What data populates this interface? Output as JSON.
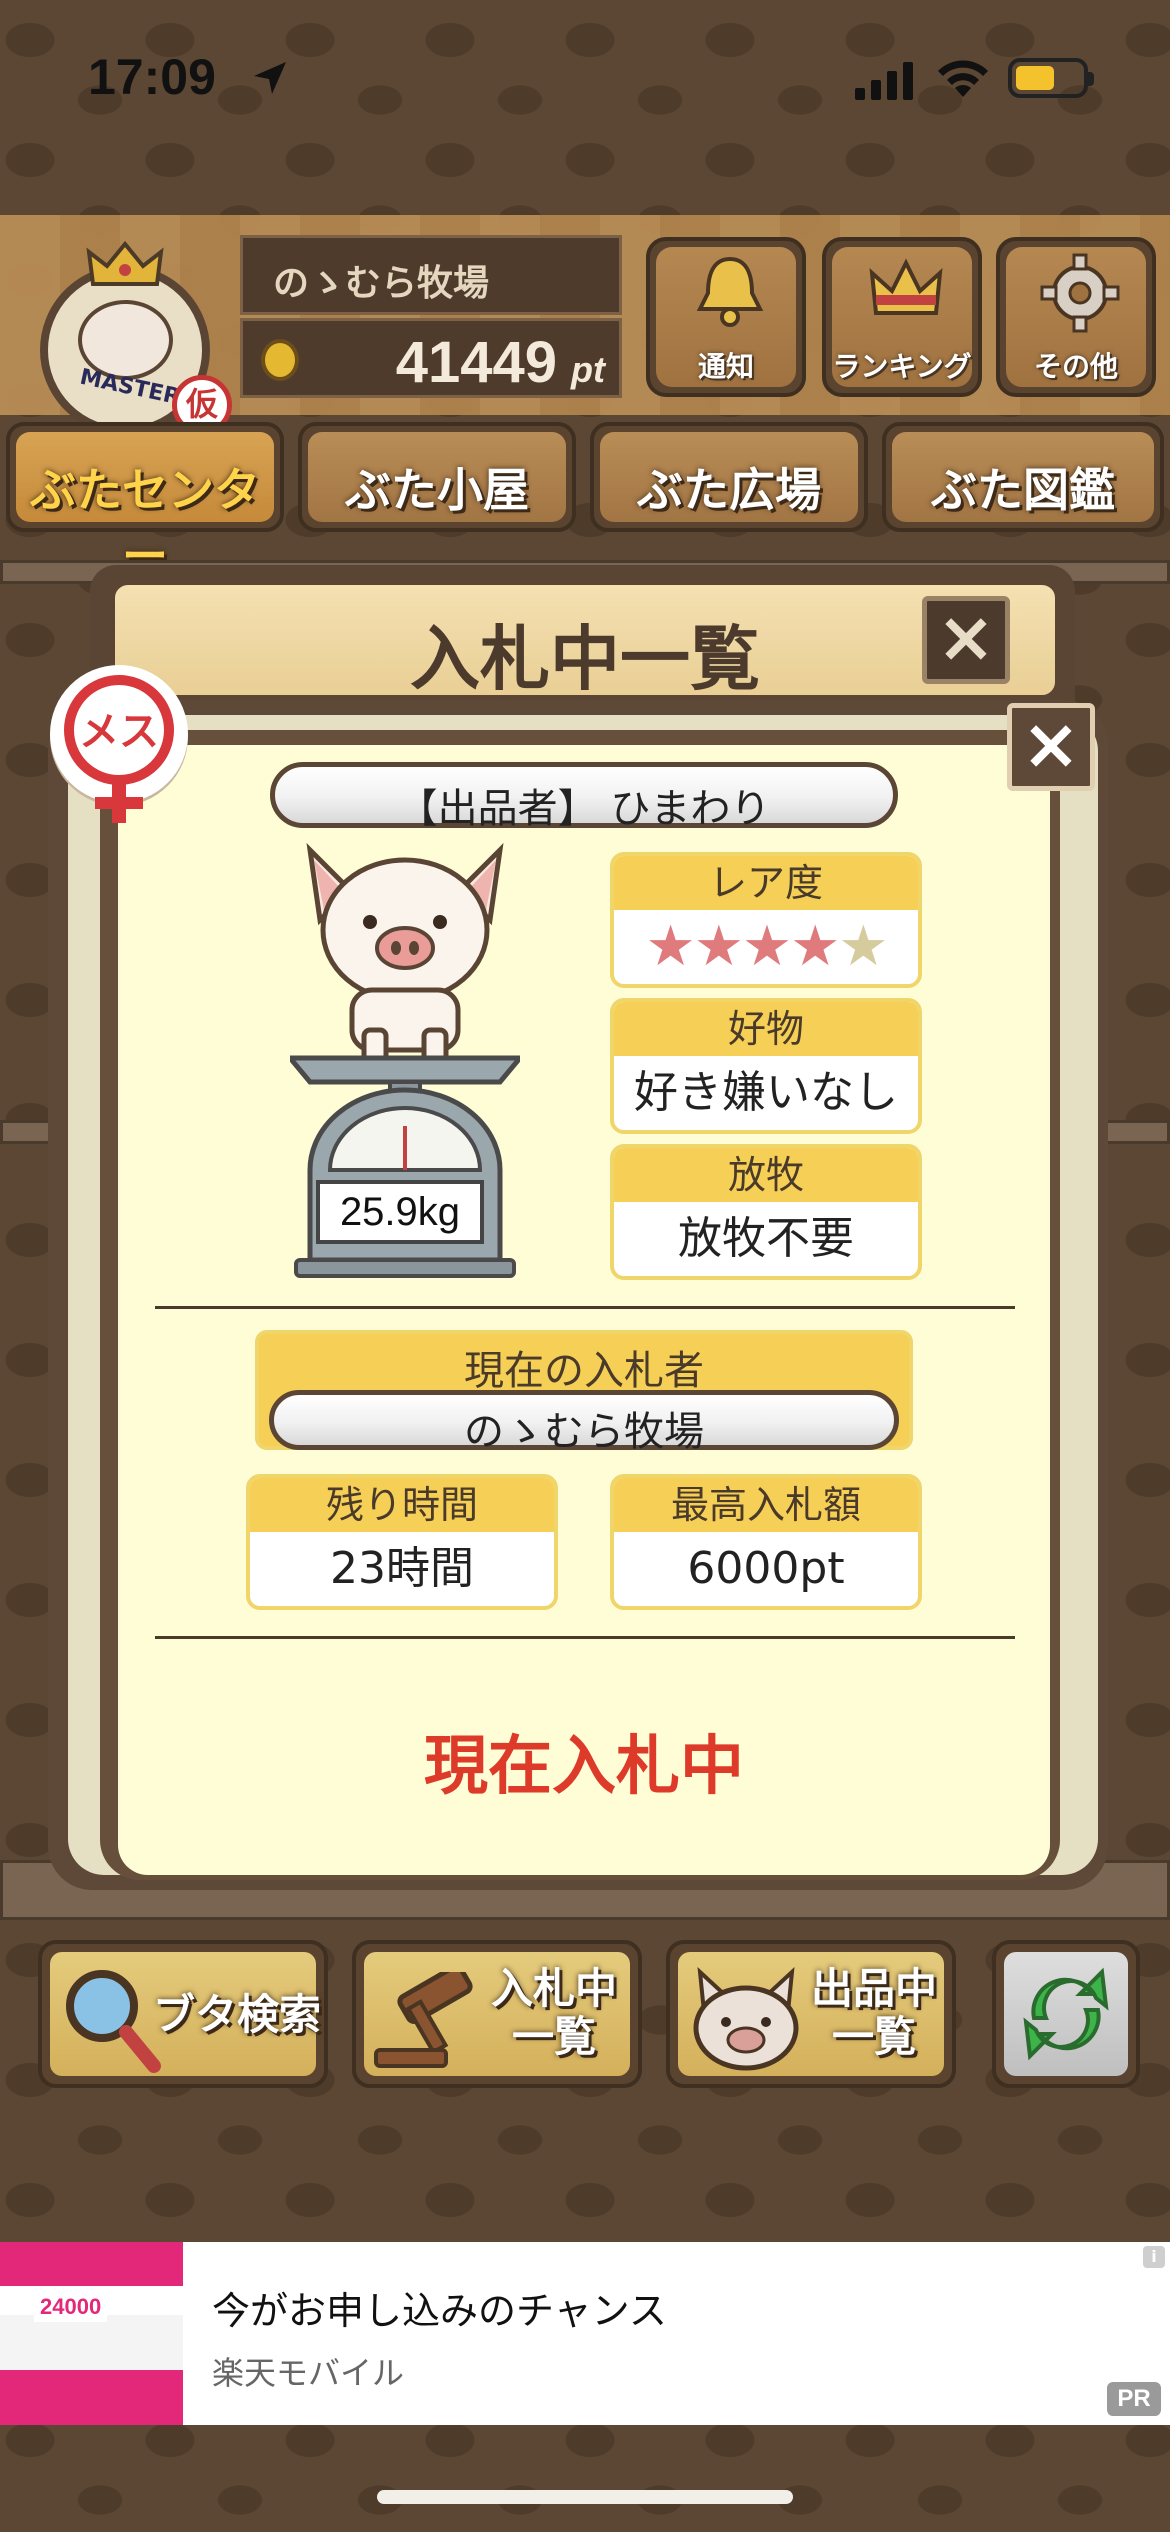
{
  "status_bar": {
    "time": "17:09"
  },
  "header": {
    "badge_text": "MASTER",
    "badge_sub": "仮",
    "farm_name": "のゝむら牧場",
    "points_value": "41449",
    "points_unit": "pt",
    "buttons": [
      {
        "label": "通知",
        "icon": "bell-icon"
      },
      {
        "label": "ランキング",
        "icon": "crown-icon"
      },
      {
        "label": "その他",
        "icon": "gear-icon"
      }
    ]
  },
  "tabs": [
    {
      "label": "ぶたセンター",
      "active": true
    },
    {
      "label": "ぶた小屋",
      "active": false
    },
    {
      "label": "ぶた広場",
      "active": false
    },
    {
      "label": "ぶた図鑑",
      "active": false
    }
  ],
  "outer_modal": {
    "title": "入札中一覧",
    "close_label": "×"
  },
  "detail": {
    "close_label": "×",
    "gender": "メス",
    "seller": "【出品者】 ひまわり",
    "weight": "25.9kg",
    "rarity": {
      "label": "レア度",
      "stars_filled": 4,
      "stars_total": 5
    },
    "favorite": {
      "label": "好物",
      "value": "好き嫌いなし"
    },
    "grazing": {
      "label": "放牧",
      "value": "放牧不要"
    },
    "current_bidder": {
      "label": "現在の入札者",
      "value": "のゝむら牧場"
    },
    "time_left": {
      "label": "残り時間",
      "value": "23時間"
    },
    "highest_bid": {
      "label": "最高入札額",
      "value": "6000pt"
    },
    "status": "現在入札中"
  },
  "bottom_buttons": [
    {
      "label": "ブタ検索",
      "icon": "magnifier-icon"
    },
    {
      "label_line1": "入札中",
      "label_line2": "一覧",
      "icon": "gavel-icon"
    },
    {
      "label_line1": "出品中",
      "label_line2": "一覧",
      "icon": "pig-face-icon"
    },
    {
      "icon": "refresh-icon"
    }
  ],
  "ad": {
    "title": "今がお申し込みのチャンス",
    "advertiser": "楽天モバイル",
    "pr_label": "PR",
    "info_label": "i",
    "image_text": "24000"
  },
  "colors": {
    "accent_red": "#dd3a2a",
    "card_yellow": "#f6cf56",
    "panel_cream": "#fffdd6",
    "wood_dark": "#5a4535"
  }
}
